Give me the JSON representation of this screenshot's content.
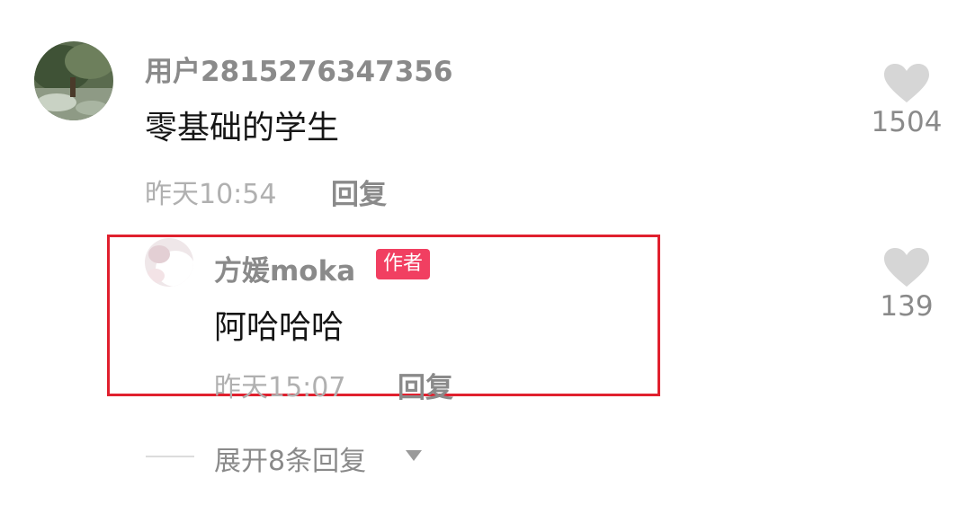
{
  "comments": [
    {
      "username": "用户2815276347356",
      "content": "零基础的学生",
      "time": "昨天10:54",
      "reply_label": "回复",
      "like_count": "1504"
    },
    {
      "username": "方媛moka",
      "badge": "作者",
      "content": "阿哈哈哈",
      "time": "昨天15:07",
      "reply_label": "回复",
      "like_count": "139"
    }
  ],
  "expand_replies_label": "展开8条回复",
  "colors": {
    "badge_bg": "#f13f61",
    "highlight_border": "#e0202e",
    "heart": "#d6d6d6"
  }
}
